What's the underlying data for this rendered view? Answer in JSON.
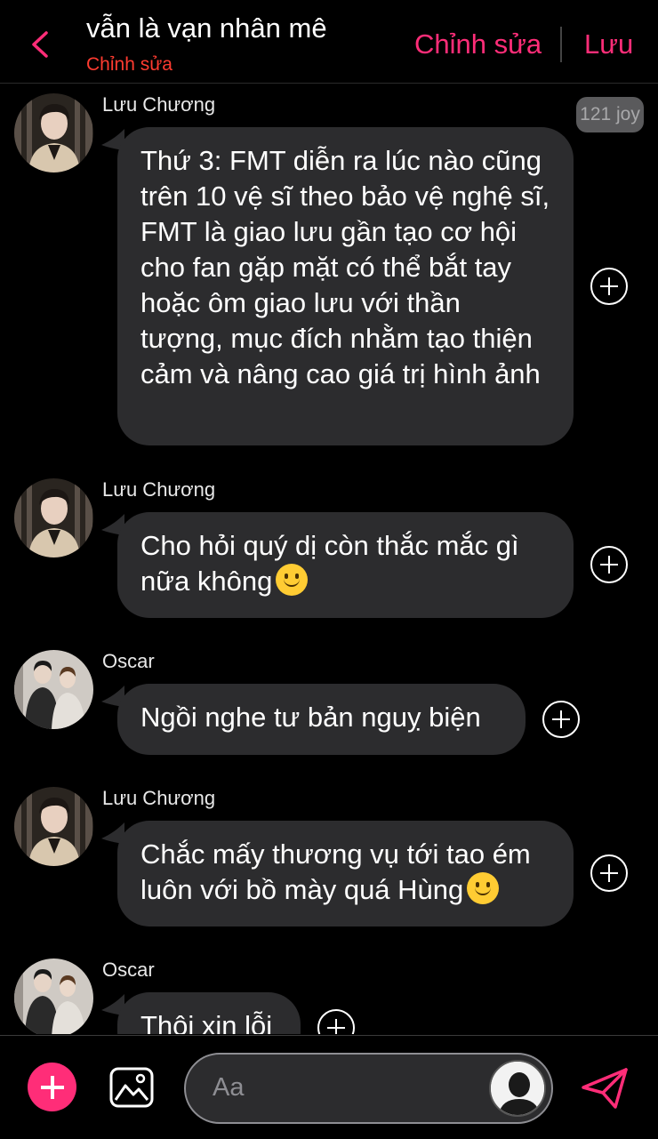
{
  "header": {
    "title": "vẫn là vạn nhân mê",
    "subtitle": "Chỉnh sửa",
    "edit_label": "Chỉnh sửa",
    "save_label": "Lưu"
  },
  "messages": [
    {
      "sender": "Lưu Chương",
      "text": "Thứ 3: FMT diễn ra lúc nào cũng trên 10 vệ sĩ theo bảo vệ nghệ sĩ, FMT là giao lưu gần tạo cơ hội cho fan gặp mặt có thể bắt tay hoặc ôm giao lưu với thần tượng, mục đích nhằm tạo thiện cảm và nâng cao giá trị hình ảnh",
      "badge": "121 joy"
    },
    {
      "sender": "Lưu Chương",
      "text": "Cho hỏi quý dị còn thắc mắc gì nữa không"
    },
    {
      "sender": "Oscar",
      "text": "Ngồi nghe tư bản nguỵ biện"
    },
    {
      "sender": "Lưu Chương",
      "text": "Chắc mấy thương vụ tới tao ém luôn với bồ mày quá Hùng"
    },
    {
      "sender": "Oscar",
      "text": "Thôi xin lỗi"
    }
  ],
  "composer": {
    "placeholder": "Aa"
  },
  "colors": {
    "accent": "#ff2d78",
    "subtitle": "#ff3b30",
    "bubble": "#2c2c2e",
    "background": "#000000"
  },
  "icons": {
    "back": "chevron-left-icon",
    "react": "add-reaction-icon",
    "plus": "plus-icon",
    "image": "image-icon",
    "send": "send-icon",
    "emoji": "slightly-smiling-face-emoji"
  }
}
